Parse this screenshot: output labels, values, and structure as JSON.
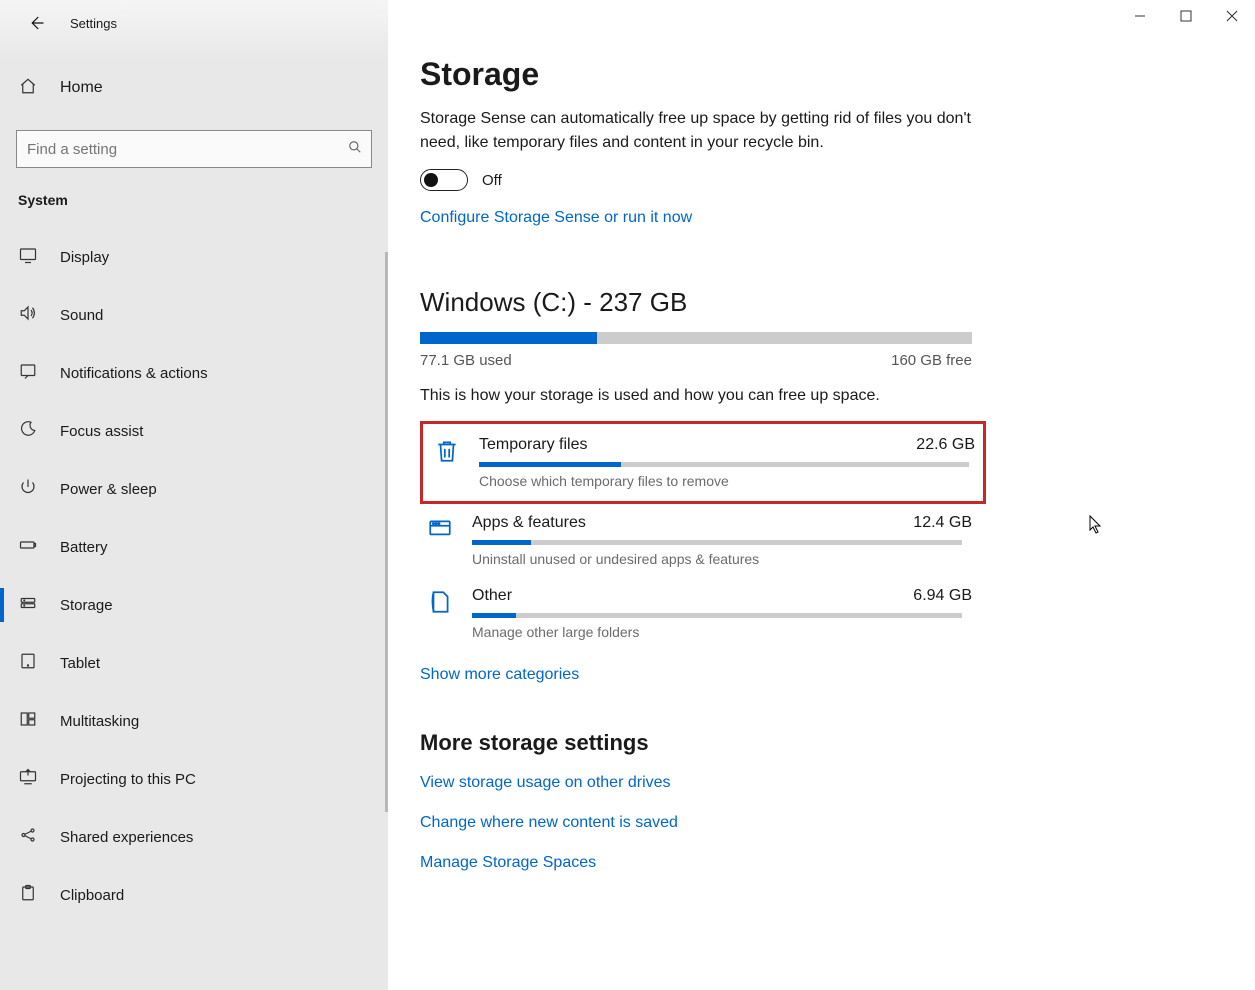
{
  "app_title": "Settings",
  "home_label": "Home",
  "search_placeholder": "Find a setting",
  "section_label": "System",
  "nav": [
    {
      "label": "Display",
      "icon": "🖵"
    },
    {
      "label": "Sound",
      "icon": "🕪"
    },
    {
      "label": "Notifications & actions",
      "icon": "▭"
    },
    {
      "label": "Focus assist",
      "icon": "☽"
    },
    {
      "label": "Power & sleep",
      "icon": "⏻"
    },
    {
      "label": "Battery",
      "icon": "▭"
    },
    {
      "label": "Storage",
      "icon": "⛃",
      "active": true
    },
    {
      "label": "Tablet",
      "icon": "▧"
    },
    {
      "label": "Multitasking",
      "icon": "⧉"
    },
    {
      "label": "Projecting to this PC",
      "icon": "⎚"
    },
    {
      "label": "Shared experiences",
      "icon": "✶"
    },
    {
      "label": "Clipboard",
      "icon": "📋"
    }
  ],
  "page": {
    "title": "Storage",
    "description": "Storage Sense can automatically free up space by getting rid of files you don't need, like temporary files and content in your recycle bin.",
    "toggle_label": "Off",
    "configure_link": "Configure Storage Sense or run it now",
    "drive_title": "Windows (C:) - 237 GB",
    "used_label": "77.1 GB used",
    "free_label": "160 GB free",
    "usage_pct": 32,
    "usage_hint": "This is how your storage is used and how you can free up space.",
    "categories": [
      {
        "name": "Temporary files",
        "size": "22.6 GB",
        "sub": "Choose which temporary files to remove",
        "pct": 29,
        "icon": "trash",
        "highlight": true
      },
      {
        "name": "Apps & features",
        "size": "12.4 GB",
        "sub": "Uninstall unused or undesired apps & features",
        "pct": 12,
        "icon": "apps"
      },
      {
        "name": "Other",
        "size": "6.94 GB",
        "sub": "Manage other large folders",
        "pct": 9,
        "icon": "other"
      }
    ],
    "show_more": "Show more categories",
    "more_heading": "More storage settings",
    "more_links": [
      "View storage usage on other drives",
      "Change where new content is saved",
      "Manage Storage Spaces"
    ]
  }
}
